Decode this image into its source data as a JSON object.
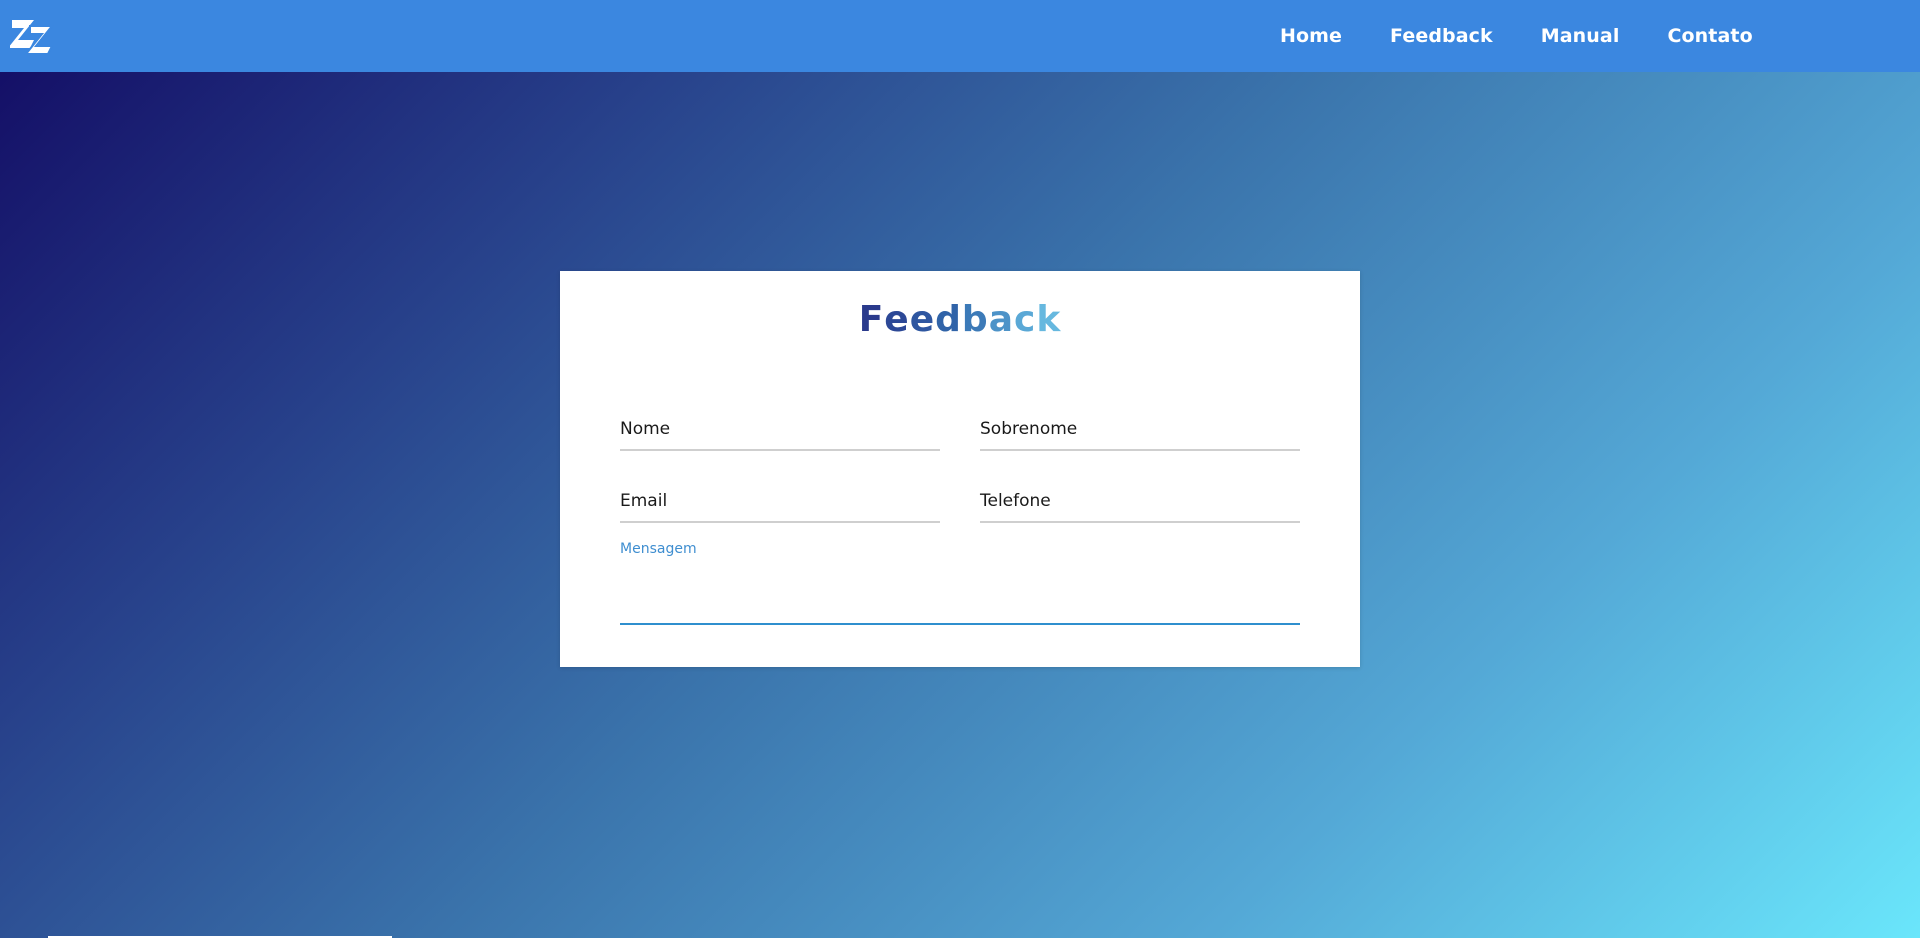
{
  "nav": {
    "logo_icon": "zz-logo-icon",
    "links": [
      {
        "label": "Home"
      },
      {
        "label": "Feedback"
      },
      {
        "label": "Manual"
      },
      {
        "label": "Contato"
      }
    ]
  },
  "form": {
    "title_letters": [
      {
        "ch": "F",
        "color": "#2a3a8c"
      },
      {
        "ch": "e",
        "color": "#2c4896"
      },
      {
        "ch": "e",
        "color": "#2e56a0"
      },
      {
        "ch": "d",
        "color": "#3063a8"
      },
      {
        "ch": "b",
        "color": "#3c7ab8"
      },
      {
        "ch": "a",
        "color": "#4d93c8"
      },
      {
        "ch": "c",
        "color": "#5aa8d6"
      },
      {
        "ch": "k",
        "color": "#66b8df"
      }
    ],
    "fields": {
      "nome": "Nome",
      "sobrenome": "Sobrenome",
      "email": "Email",
      "telefone": "Telefone",
      "mensagem": "Mensagem"
    }
  },
  "colors": {
    "navbar": "#3b87e0",
    "active_underline": "#2f8fce",
    "label_active": "#3f8ed0"
  }
}
